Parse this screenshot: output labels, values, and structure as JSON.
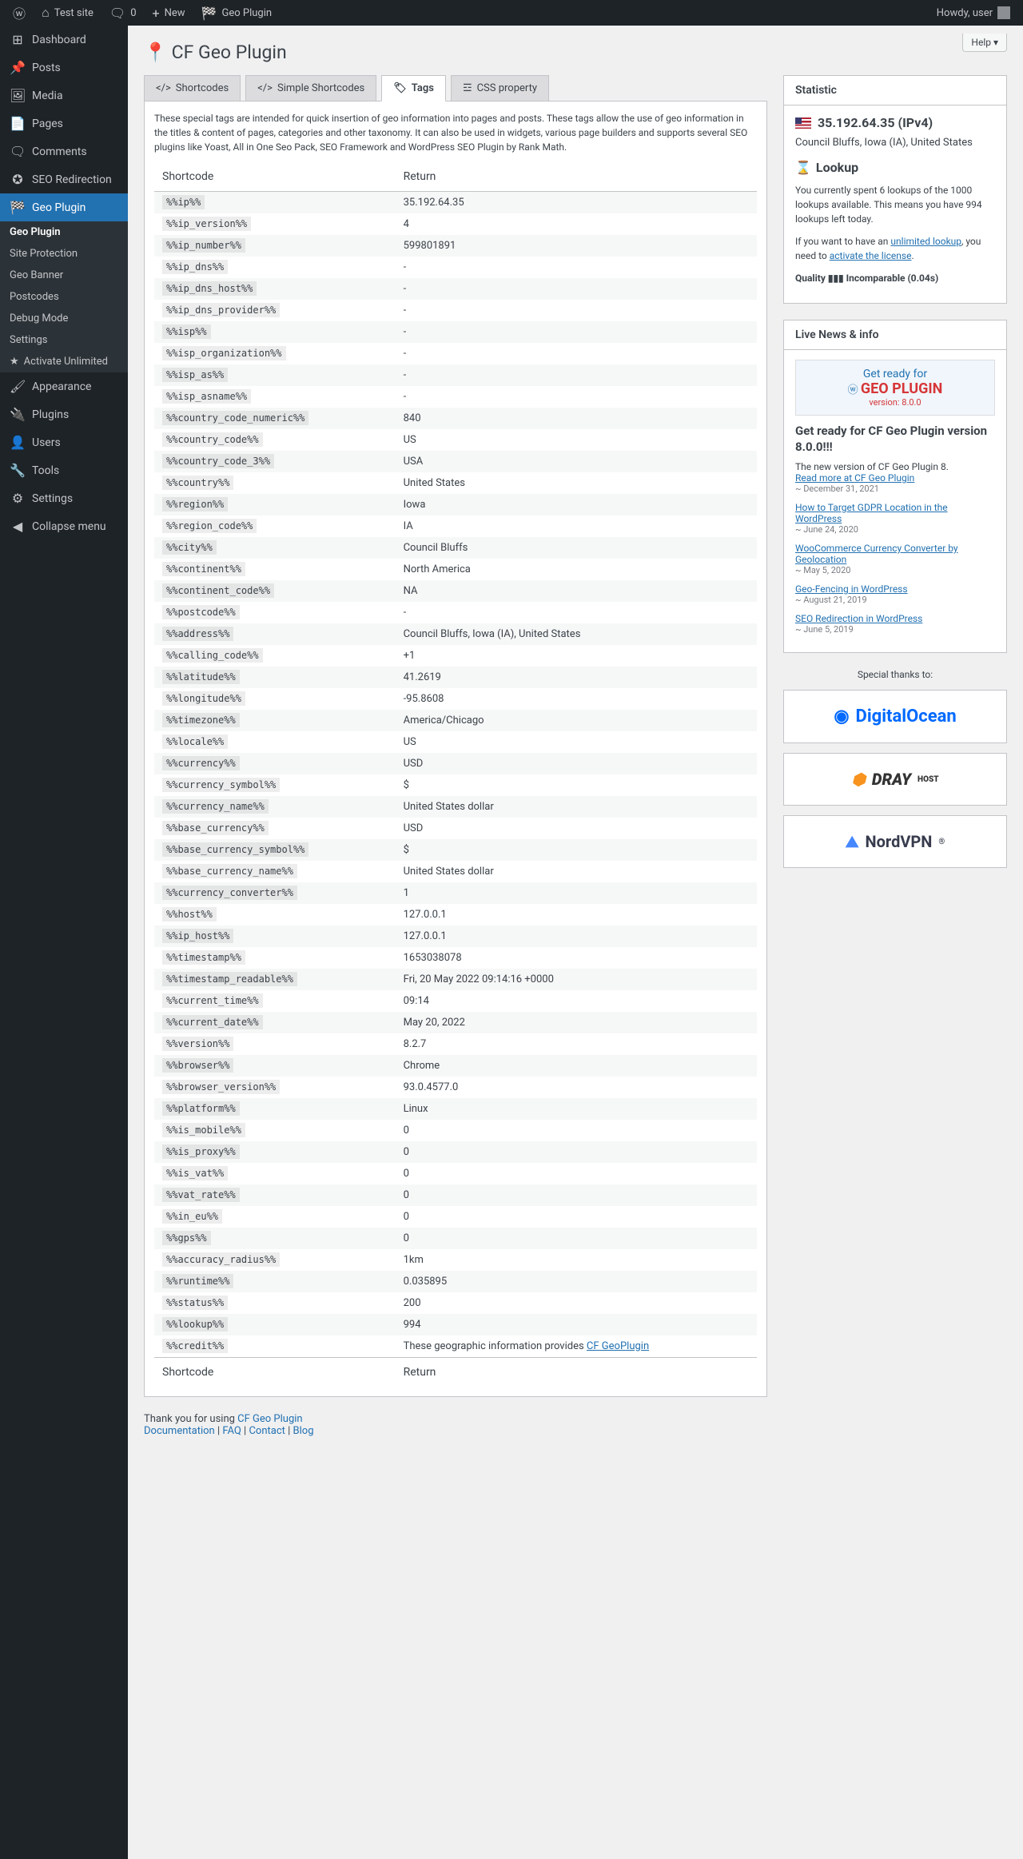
{
  "adminbar": {
    "site": "Test site",
    "comments": "0",
    "new": "New",
    "plugin": "Geo Plugin",
    "howdy": "Howdy, user"
  },
  "menu": {
    "dashboard": "Dashboard",
    "posts": "Posts",
    "media": "Media",
    "pages": "Pages",
    "comments": "Comments",
    "seo": "SEO Redirection",
    "geo": "Geo Plugin",
    "appearance": "Appearance",
    "plugins": "Plugins",
    "users": "Users",
    "tools": "Tools",
    "settings": "Settings",
    "collapse": "Collapse menu"
  },
  "submenu": {
    "geo": "Geo Plugin",
    "site": "Site Protection",
    "banner": "Geo Banner",
    "postcodes": "Postcodes",
    "debug": "Debug Mode",
    "settings": "Settings",
    "activate": "Activate Unlimited"
  },
  "page": {
    "title": "CF Geo Plugin",
    "help": "Help"
  },
  "tabs": {
    "shortcodes": "Shortcodes",
    "simple": "Simple Shortcodes",
    "tags": "Tags",
    "css": "CSS property"
  },
  "desc": "These special tags are intended for quick insertion of geo information into pages and posts. These tags allow the use of geo information in the titles & content of pages, categories and other taxonomy. It can also be used in widgets, various page builders and supports several SEO plugins like Yoast, All in One Seo Pack, SEO Framework and WordPress SEO Plugin by Rank Math.",
  "th": {
    "shortcode": "Shortcode",
    "return": "Return"
  },
  "rows": [
    {
      "s": "%%ip%%",
      "r": "35.192.64.35"
    },
    {
      "s": "%%ip_version%%",
      "r": "4"
    },
    {
      "s": "%%ip_number%%",
      "r": "599801891"
    },
    {
      "s": "%%ip_dns%%",
      "r": "-"
    },
    {
      "s": "%%ip_dns_host%%",
      "r": "-"
    },
    {
      "s": "%%ip_dns_provider%%",
      "r": "-"
    },
    {
      "s": "%%isp%%",
      "r": "-"
    },
    {
      "s": "%%isp_organization%%",
      "r": "-"
    },
    {
      "s": "%%isp_as%%",
      "r": "-"
    },
    {
      "s": "%%isp_asname%%",
      "r": "-"
    },
    {
      "s": "%%country_code_numeric%%",
      "r": "840"
    },
    {
      "s": "%%country_code%%",
      "r": "US"
    },
    {
      "s": "%%country_code_3%%",
      "r": "USA"
    },
    {
      "s": "%%country%%",
      "r": "United States"
    },
    {
      "s": "%%region%%",
      "r": "Iowa"
    },
    {
      "s": "%%region_code%%",
      "r": "IA"
    },
    {
      "s": "%%city%%",
      "r": "Council Bluffs"
    },
    {
      "s": "%%continent%%",
      "r": "North America"
    },
    {
      "s": "%%continent_code%%",
      "r": "NA"
    },
    {
      "s": "%%postcode%%",
      "r": "-"
    },
    {
      "s": "%%address%%",
      "r": "Council Bluffs, Iowa (IA), United States"
    },
    {
      "s": "%%calling_code%%",
      "r": "+1"
    },
    {
      "s": "%%latitude%%",
      "r": "41.2619"
    },
    {
      "s": "%%longitude%%",
      "r": "-95.8608"
    },
    {
      "s": "%%timezone%%",
      "r": "America/Chicago"
    },
    {
      "s": "%%locale%%",
      "r": "US"
    },
    {
      "s": "%%currency%%",
      "r": "USD"
    },
    {
      "s": "%%currency_symbol%%",
      "r": "$"
    },
    {
      "s": "%%currency_name%%",
      "r": "United States dollar"
    },
    {
      "s": "%%base_currency%%",
      "r": "USD"
    },
    {
      "s": "%%base_currency_symbol%%",
      "r": "$"
    },
    {
      "s": "%%base_currency_name%%",
      "r": "United States dollar"
    },
    {
      "s": "%%currency_converter%%",
      "r": "1"
    },
    {
      "s": "%%host%%",
      "r": "127.0.0.1"
    },
    {
      "s": "%%ip_host%%",
      "r": "127.0.0.1"
    },
    {
      "s": "%%timestamp%%",
      "r": "1653038078"
    },
    {
      "s": "%%timestamp_readable%%",
      "r": "Fri, 20 May 2022 09:14:16 +0000"
    },
    {
      "s": "%%current_time%%",
      "r": "09:14"
    },
    {
      "s": "%%current_date%%",
      "r": "May 20, 2022"
    },
    {
      "s": "%%version%%",
      "r": "8.2.7"
    },
    {
      "s": "%%browser%%",
      "r": "Chrome"
    },
    {
      "s": "%%browser_version%%",
      "r": "93.0.4577.0"
    },
    {
      "s": "%%platform%%",
      "r": "Linux"
    },
    {
      "s": "%%is_mobile%%",
      "r": "0"
    },
    {
      "s": "%%is_proxy%%",
      "r": "0"
    },
    {
      "s": "%%is_vat%%",
      "r": "0"
    },
    {
      "s": "%%vat_rate%%",
      "r": "0"
    },
    {
      "s": "%%in_eu%%",
      "r": "0"
    },
    {
      "s": "%%gps%%",
      "r": "0"
    },
    {
      "s": "%%accuracy_radius%%",
      "r": "1km"
    },
    {
      "s": "%%runtime%%",
      "r": "0.035895"
    },
    {
      "s": "%%status%%",
      "r": "200"
    },
    {
      "s": "%%lookup%%",
      "r": "994"
    }
  ],
  "credit": {
    "s": "%%credit%%",
    "pre": "These geographic information provides ",
    "link": "CF GeoPlugin"
  },
  "stat": {
    "h": "Statistic",
    "ip": "35.192.64.35 (IPv4)",
    "loc": "Council Bluffs, Iowa (IA), United States",
    "lookup": "Lookup",
    "p1": "You currently spent 6 lookups of the 1000 lookups available. This means you have 994 lookups left today.",
    "p2a": "If you want to have an ",
    "p2link1": "unlimited lookup",
    "p2b": ", you need to ",
    "p2link2": "activate the license",
    "p2c": ".",
    "quality": "Quality ▮▮▮ Incomparable (0.04s)"
  },
  "news": {
    "h": "Live News & info",
    "img1": "Get ready for",
    "img2": "GEO PLUGIN",
    "img3": "version: 8.0.0",
    "title": "Get ready for CF Geo Plugin version 8.0.0!!!",
    "lead": "The new version of CF Geo Plugin 8.",
    "readmore": "Read more at CF Geo Plugin",
    "d0": "~ December 31, 2021",
    "items": [
      {
        "t": "How to Target GDPR Location in the WordPress",
        "d": "~ June 24, 2020"
      },
      {
        "t": "WooCommerce Currency Converter by Geolocation",
        "d": "~ May 5, 2020"
      },
      {
        "t": "Geo-Fencing in WordPress",
        "d": "~ August 21, 2019"
      },
      {
        "t": "SEO Redirection in WordPress",
        "d": "~ June 5, 2019"
      }
    ]
  },
  "thanks": "Special thanks to:",
  "sponsors": {
    "do": "DigitalOcean",
    "dray": "DRAY",
    "drayh": "HOST",
    "nord": "NordVPN"
  },
  "footer": {
    "pre": "Thank you for using ",
    "link": "CF Geo Plugin",
    "doc": "Documentation",
    "faq": "FAQ",
    "contact": "Contact",
    "blog": "Blog"
  }
}
